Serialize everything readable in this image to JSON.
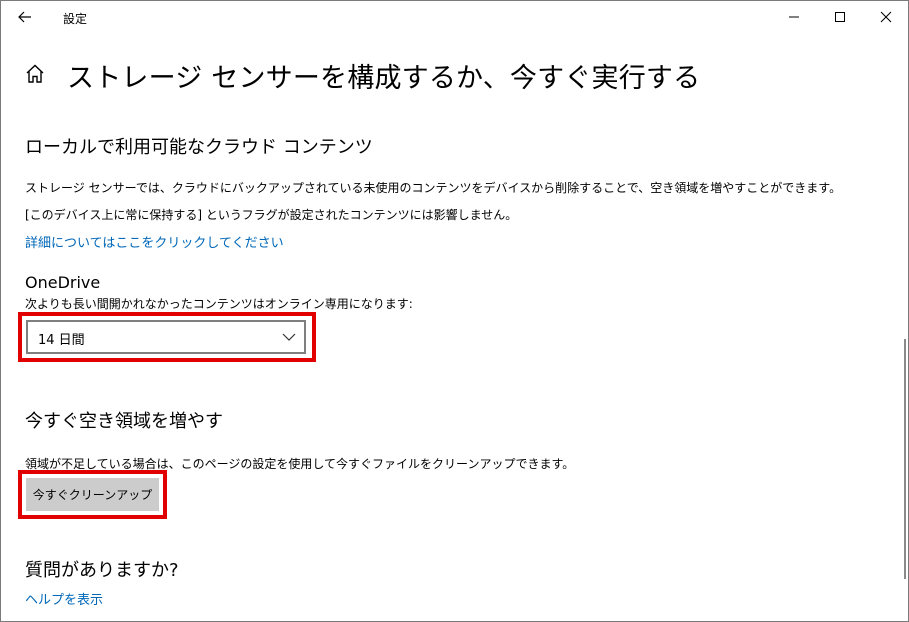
{
  "window": {
    "title": "設定",
    "minimize_icon": "minimize-icon",
    "maximize_icon": "maximize-icon",
    "close_icon": "close-icon",
    "back_icon": "back-arrow-icon"
  },
  "header": {
    "home_icon": "home-icon",
    "title": "ストレージ センサーを構成するか、今すぐ実行する"
  },
  "local_cloud": {
    "heading": "ローカルで利用可能なクラウド コンテンツ",
    "description_line1": "ストレージ センサーでは、クラウドにバックアップされている未使用のコンテンツをデバイスから削除することで、空き領域を増やすことができます。",
    "description_line2": "[このデバイス上に常に保持する] というフラグが設定されたコンテンツには影響しません。",
    "learn_more_link": "詳細についてはここをクリックしてください"
  },
  "onedrive": {
    "heading": "OneDrive",
    "label": "次よりも長い間開かれなかったコンテンツはオンライン専用になります:",
    "selected_value": "14 日間",
    "chevron_icon": "chevron-down-icon"
  },
  "free_space": {
    "heading": "今すぐ空き領域を増やす",
    "description": "領域が不足している場合は、このページの設定を使用して今すぐファイルをクリーンアップできます。",
    "button_label": "今すぐクリーンアップ"
  },
  "help": {
    "heading": "質問がありますか?",
    "link": "ヘルプを表示"
  },
  "colors": {
    "accent_link": "#0067b8",
    "highlight_border": "#e10000",
    "button_bg": "#cccccc"
  }
}
